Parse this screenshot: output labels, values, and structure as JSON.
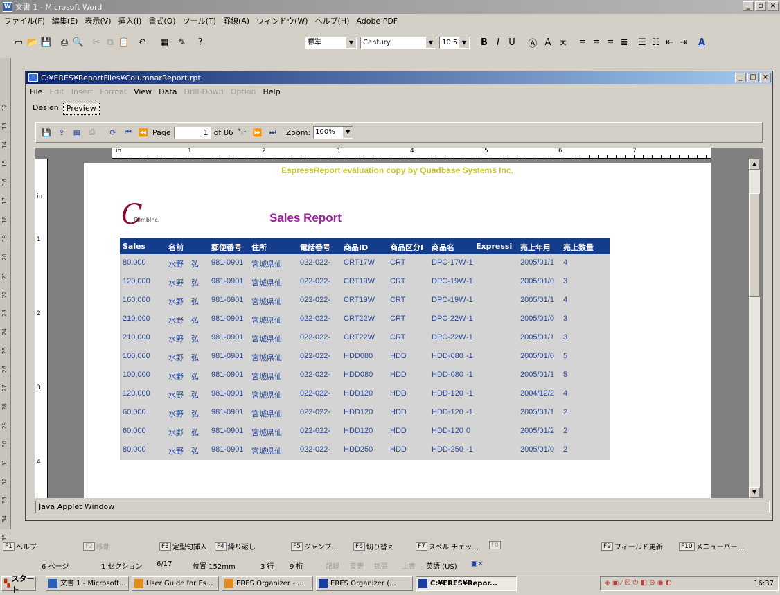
{
  "word": {
    "title": "文書 1 - Microsoft Word",
    "menu": [
      "ファイル(F)",
      "編集(E)",
      "表示(V)",
      "挿入(I)",
      "書式(O)",
      "ツール(T)",
      "罫線(A)",
      "ウィンドウ(W)",
      "ヘルプ(H)",
      "Adobe PDF"
    ],
    "style_combo": "標準",
    "font_combo": "Century",
    "size_combo": "10.5",
    "vruler_numbers": [
      "12",
      "13",
      "14",
      "15",
      "16",
      "17",
      "18",
      "19",
      "20",
      "21",
      "22",
      "23",
      "24",
      "25",
      "26",
      "27",
      "28",
      "29",
      "30",
      "31",
      "32",
      "33",
      "34",
      "35"
    ]
  },
  "report_window": {
    "title": "C:¥ERES¥ReportFiles¥ColumnarReport.rpt",
    "menu": [
      {
        "label": "File",
        "enabled": true
      },
      {
        "label": "Edit",
        "enabled": false
      },
      {
        "label": "Insert",
        "enabled": false
      },
      {
        "label": "Format",
        "enabled": false
      },
      {
        "label": "View",
        "enabled": true
      },
      {
        "label": "Data",
        "enabled": true
      },
      {
        "label": "Drill-Down",
        "enabled": false
      },
      {
        "label": "Option",
        "enabled": false
      },
      {
        "label": "Help",
        "enabled": true
      }
    ],
    "tabs": {
      "design": "Desien",
      "preview": "Preview"
    },
    "toolbar": {
      "page_label": "Page",
      "page_value": "1",
      "of_label": "of 86",
      "zoom_label": "Zoom:",
      "zoom_value": "100%"
    },
    "ruler_unit": "in",
    "hruler_numbers": [
      "1",
      "2",
      "3",
      "4",
      "5",
      "6",
      "7"
    ],
    "vruler_numbers": [
      "1",
      "2",
      "3",
      "4"
    ],
    "applet_status": "Java Applet Window"
  },
  "report": {
    "watermark": "EspressReport evaluation copy by Quadbase Systems Inc.",
    "logo_text": "ClimbInc.",
    "title": "Sales Report",
    "columns": [
      "Sales",
      "名前",
      "郵便番号",
      "住所",
      "電話番号",
      "商品ID",
      "商品区分I",
      "商品名",
      "Expressi",
      "売上年月",
      "売上数量"
    ],
    "rows": [
      [
        "80,000",
        "水野　弘",
        "981-0901",
        "宮城県仙",
        "022-022-",
        "CRT17W",
        "CRT",
        "DPC-17W",
        "-1",
        "2005/01/1",
        "4"
      ],
      [
        "120,000",
        "水野　弘",
        "981-0901",
        "宮城県仙",
        "022-022-",
        "CRT19W",
        "CRT",
        "DPC-19W",
        "-1",
        "2005/01/0",
        "3"
      ],
      [
        "160,000",
        "水野　弘",
        "981-0901",
        "宮城県仙",
        "022-022-",
        "CRT19W",
        "CRT",
        "DPC-19W",
        "-1",
        "2005/01/1",
        "4"
      ],
      [
        "210,000",
        "水野　弘",
        "981-0901",
        "宮城県仙",
        "022-022-",
        "CRT22W",
        "CRT",
        "DPC-22W",
        "-1",
        "2005/01/0",
        "3"
      ],
      [
        "210,000",
        "水野　弘",
        "981-0901",
        "宮城県仙",
        "022-022-",
        "CRT22W",
        "CRT",
        "DPC-22W",
        "-1",
        "2005/01/1",
        "3"
      ],
      [
        "100,000",
        "水野　弘",
        "981-0901",
        "宮城県仙",
        "022-022-",
        "HDD080",
        "HDD",
        "HDD-080",
        "-1",
        "2005/01/0",
        "5"
      ],
      [
        "100,000",
        "水野　弘",
        "981-0901",
        "宮城県仙",
        "022-022-",
        "HDD080",
        "HDD",
        "HDD-080",
        "-1",
        "2005/01/1",
        "5"
      ],
      [
        "120,000",
        "水野　弘",
        "981-0901",
        "宮城県仙",
        "022-022-",
        "HDD120",
        "HDD",
        "HDD-120",
        "-1",
        "2004/12/2",
        "4"
      ],
      [
        "60,000",
        "水野　弘",
        "981-0901",
        "宮城県仙",
        "022-022-",
        "HDD120",
        "HDD",
        "HDD-120",
        "-1",
        "2005/01/1",
        "2"
      ],
      [
        "60,000",
        "水野　弘",
        "981-0901",
        "宮城県仙",
        "022-022-",
        "HDD120",
        "HDD",
        "HDD-120",
        "0",
        "2005/01/2",
        "2"
      ],
      [
        "80,000",
        "水野　弘",
        "981-0901",
        "宮城県仙",
        "022-022-",
        "HDD250",
        "HDD",
        "HDD-250",
        "-1",
        "2005/01/0",
        "2"
      ]
    ]
  },
  "fkeys": [
    {
      "key": "F1",
      "label": "ヘルプ",
      "dim": false
    },
    {
      "key": "F2",
      "label": "移動",
      "dim": true
    },
    {
      "key": "F3",
      "label": "定型句挿入",
      "dim": false
    },
    {
      "key": "F4",
      "label": "繰り返し",
      "dim": false
    },
    {
      "key": "F5",
      "label": "ジャンプ...",
      "dim": false
    },
    {
      "key": "F6",
      "label": "切り替え",
      "dim": false
    },
    {
      "key": "F7",
      "label": "スペル チェッ...",
      "dim": false
    },
    {
      "key": "F8",
      "label": "",
      "dim": true
    },
    {
      "key": "F9",
      "label": "フィールド更新",
      "dim": false
    },
    {
      "key": "F10",
      "label": "メニューバー...",
      "dim": false
    }
  ],
  "status": {
    "page": "6 ページ",
    "section": "1 セクション",
    "pages": "6/17",
    "position": "位置 152mm",
    "line": "3 行",
    "col": "9 桁",
    "rec": "記録",
    "trk": "変更",
    "ext": "拡張",
    "ovr": "上書",
    "lang": "英語 (US)"
  },
  "taskbar": {
    "start": "スタート",
    "tasks": [
      {
        "label": "文書 1 - Microsoft...",
        "active": false
      },
      {
        "label": "User Guide for Es...",
        "active": false
      },
      {
        "label": "ERES Organizer - ...",
        "active": false
      },
      {
        "label": "ERES Organizer (...",
        "active": false
      },
      {
        "label": "C:¥ERES¥Repor...",
        "active": true
      }
    ],
    "clock": "16:37"
  },
  "colors": {
    "header_bg": "#143c8c",
    "body_bg": "#d4d4d4",
    "row_text": "#2a4c9a",
    "title": "#a020a0",
    "watermark": "#c8c830"
  }
}
